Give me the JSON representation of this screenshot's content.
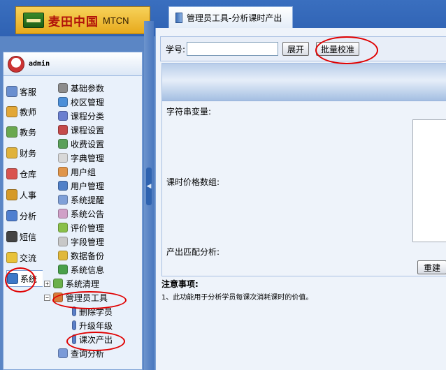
{
  "header": {
    "logo_cn": "麦田中国",
    "logo_en": "MTCN",
    "tab_label": "管理员工具-分析课时产出"
  },
  "user": {
    "name": "admin"
  },
  "categories": [
    {
      "label": "客服",
      "icon": "customer-service-icon",
      "color": "#6a8fd0"
    },
    {
      "label": "教师",
      "icon": "teacher-icon",
      "color": "#e2a737"
    },
    {
      "label": "教务",
      "icon": "academic-icon",
      "color": "#6aa84f"
    },
    {
      "label": "财务",
      "icon": "finance-icon",
      "color": "#e0b23a"
    },
    {
      "label": "仓库",
      "icon": "warehouse-icon",
      "color": "#d9534f"
    },
    {
      "label": "人事",
      "icon": "hr-icon",
      "color": "#d69a28"
    },
    {
      "label": "分析",
      "icon": "analysis-icon",
      "color": "#4f7fd0"
    },
    {
      "label": "短信",
      "icon": "sms-icon",
      "color": "#444444"
    },
    {
      "label": "交流",
      "icon": "chat-icon",
      "color": "#e8c23a"
    },
    {
      "label": "系统",
      "icon": "system-icon",
      "color": "#3c78c8"
    }
  ],
  "tree": [
    {
      "label": "基础参数",
      "icon": "gear-icon",
      "color": "#8c8c8c"
    },
    {
      "label": "校区管理",
      "icon": "globe-icon",
      "color": "#4c8fd8"
    },
    {
      "label": "课程分类",
      "icon": "book-stack-icon",
      "color": "#6a7fd0"
    },
    {
      "label": "课程设置",
      "icon": "books-icon",
      "color": "#c44a4a"
    },
    {
      "label": "收费设置",
      "icon": "money-icon",
      "color": "#5aa05a"
    },
    {
      "label": "字典管理",
      "icon": "dictionary-icon",
      "color": "#d8d8d8"
    },
    {
      "label": "用户组",
      "icon": "user-group-icon",
      "color": "#e0954a"
    },
    {
      "label": "用户管理",
      "icon": "user-icon",
      "color": "#5080c8"
    },
    {
      "label": "系统提醒",
      "icon": "speaker-icon",
      "color": "#7fa0d8"
    },
    {
      "label": "系统公告",
      "icon": "notice-icon",
      "color": "#d0a0c8"
    },
    {
      "label": "评价管理",
      "icon": "evaluation-icon",
      "color": "#8ac04a"
    },
    {
      "label": "字段管理",
      "icon": "field-icon",
      "color": "#c8c8c8"
    },
    {
      "label": "数据备份",
      "icon": "database-icon",
      "color": "#e0b83a"
    },
    {
      "label": "系统信息",
      "icon": "info-icon",
      "color": "#4aa04a"
    },
    {
      "label": "系统清理",
      "icon": "cleanup-icon",
      "color": "#6ab04a",
      "expander": "+"
    },
    {
      "label": "管理员工具",
      "icon": "admin-tools-icon",
      "color": "#d87a3a",
      "expander": "−"
    }
  ],
  "admin_children": [
    {
      "label": "删除学员",
      "icon": "delete-student-icon"
    },
    {
      "label": "升级年级",
      "icon": "upgrade-grade-icon"
    },
    {
      "label": "课次产出",
      "icon": "lesson-output-icon"
    }
  ],
  "tree_last": {
    "label": "查询分析",
    "icon": "query-icon",
    "color": "#7a9ad8"
  },
  "query": {
    "student_no_label": "学号:",
    "student_no_value": "",
    "expand_label": "展开",
    "batch_label": "批量校准"
  },
  "form": {
    "string_var_label": "字符串变量:",
    "price_array_label": "课时价格数组:",
    "match_label": "产出匹配分析:",
    "reset_label": "重建"
  },
  "notes": {
    "title": "注意事项:",
    "line1": "1、此功能用于分析学员每课次消耗课时的价值。"
  }
}
